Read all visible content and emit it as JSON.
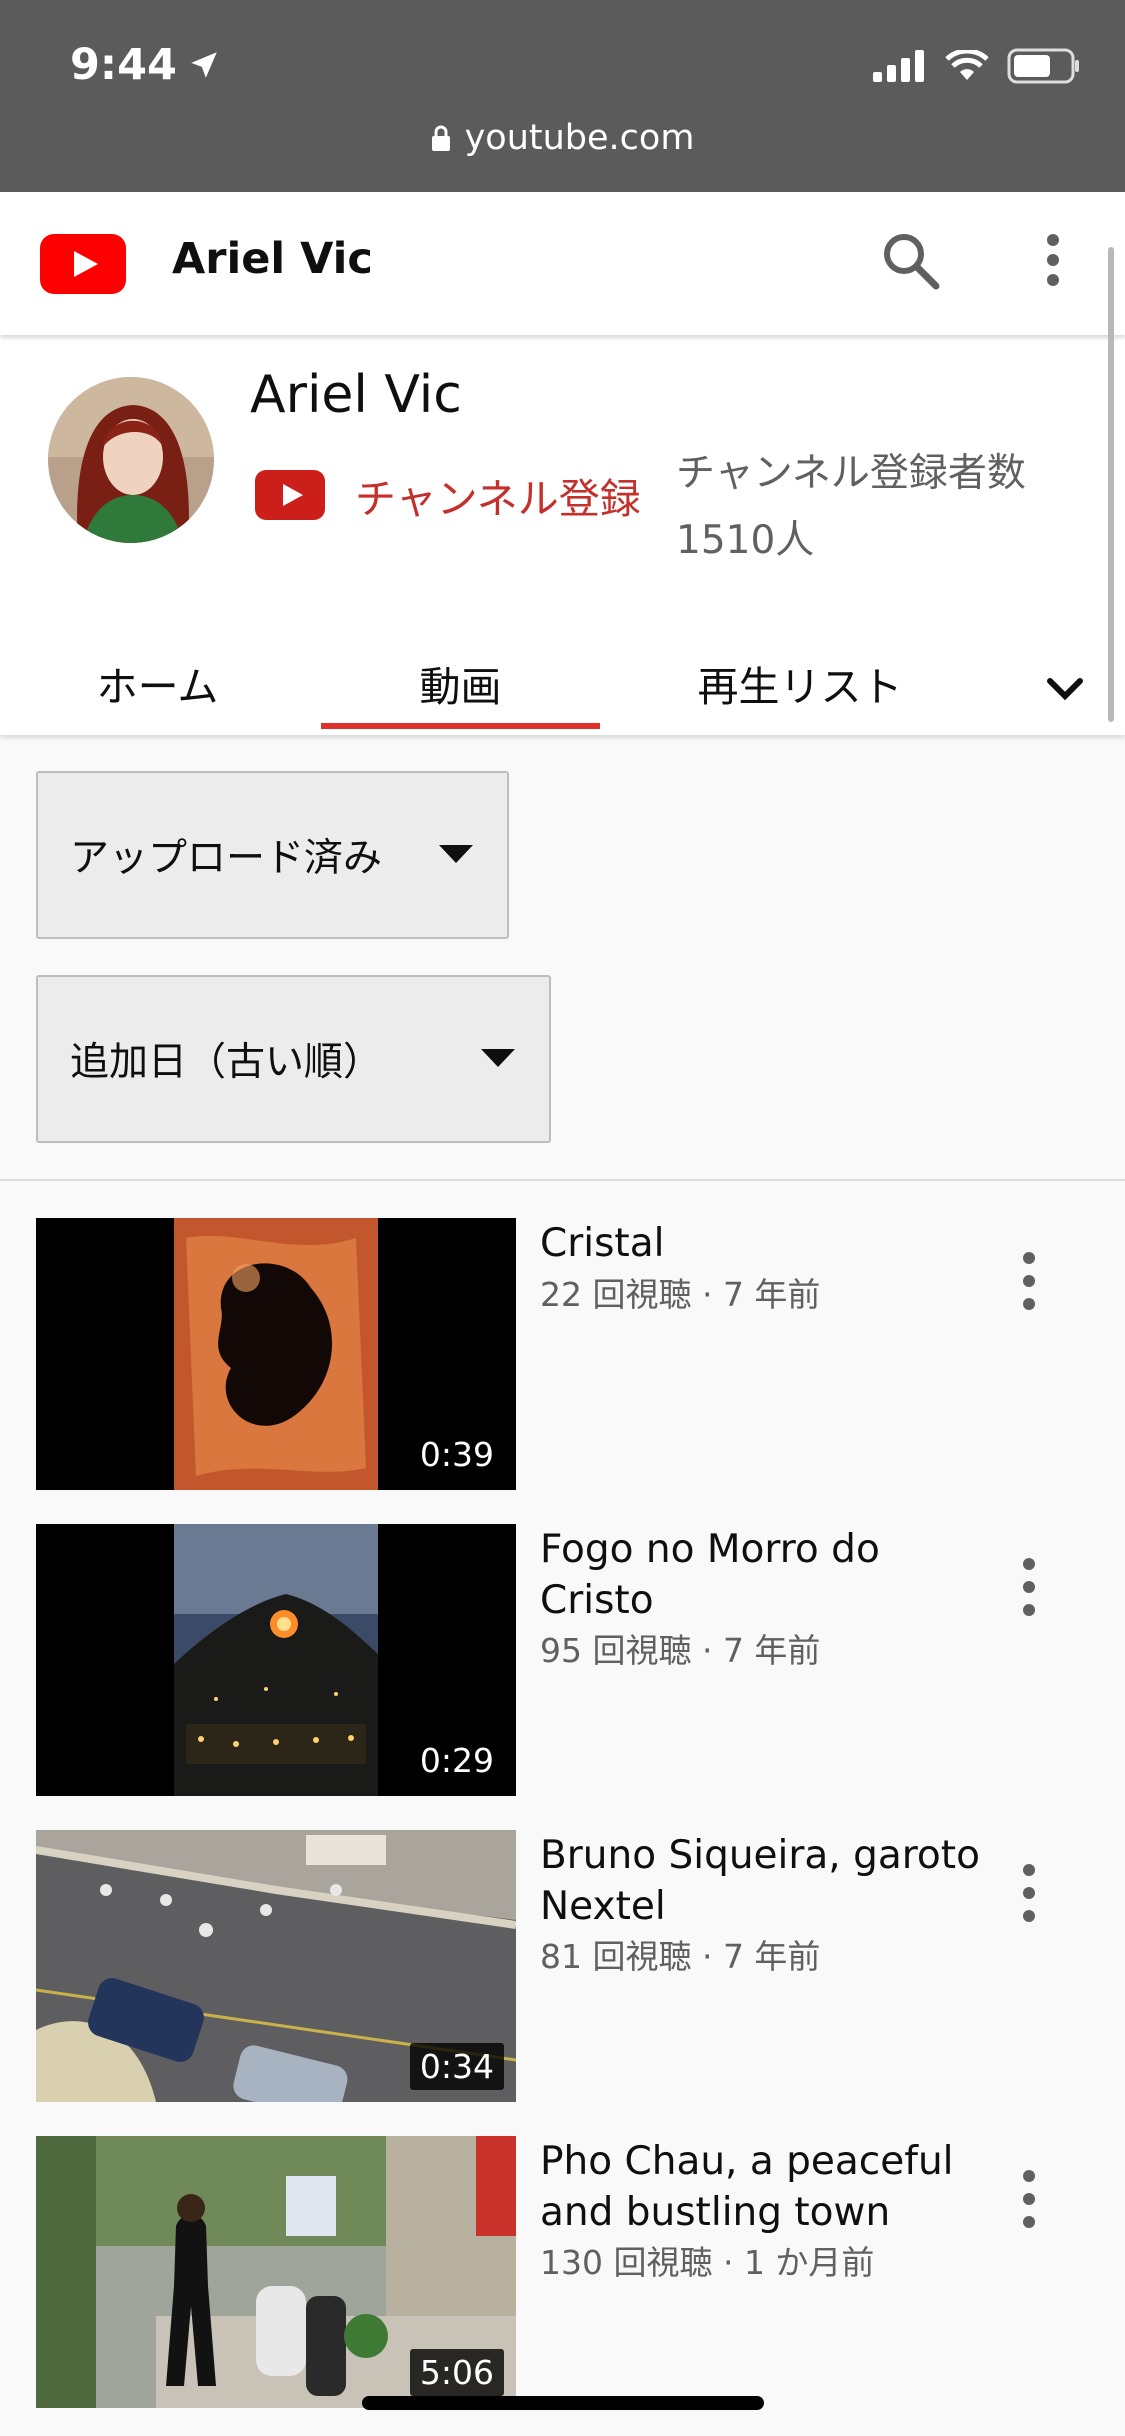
{
  "status_bar": {
    "time": "9:44",
    "url": "youtube.com"
  },
  "header": {
    "title": "Ariel Vic"
  },
  "channel": {
    "name": "Ariel Vic",
    "subscribe_label": "チャンネル登録",
    "subscriber_count": "チャンネル登録者数 1510人"
  },
  "tabs": [
    {
      "label": "ホーム"
    },
    {
      "label": "動画"
    },
    {
      "label": "再生リスト"
    }
  ],
  "filters": {
    "uploads": "アップロード済み",
    "sort": "追加日（古い順）"
  },
  "videos": [
    {
      "title": "Cristal",
      "meta": "22 回視聴 · 7 年前",
      "duration": "0:39"
    },
    {
      "title": "Fogo no Morro do Cristo",
      "meta": "95 回視聴 · 7 年前",
      "duration": "0:29"
    },
    {
      "title": "Bruno Siqueira, garoto Nextel",
      "meta": "81 回視聴 · 7 年前",
      "duration": "0:34"
    },
    {
      "title": "Pho Chau, a peaceful and bustling town",
      "meta": "130 回視聴 · 1 か月前",
      "duration": "5:06"
    }
  ],
  "colors": {
    "accent": "#e0302b",
    "brand_red": "#ff0000"
  },
  "icons": [
    "location-arrow-icon",
    "signal-icon",
    "wifi-icon",
    "battery-icon",
    "lock-icon",
    "youtube-logo-icon",
    "search-icon",
    "more-vert-icon",
    "chevron-down-icon",
    "dropdown-arrow-icon"
  ]
}
